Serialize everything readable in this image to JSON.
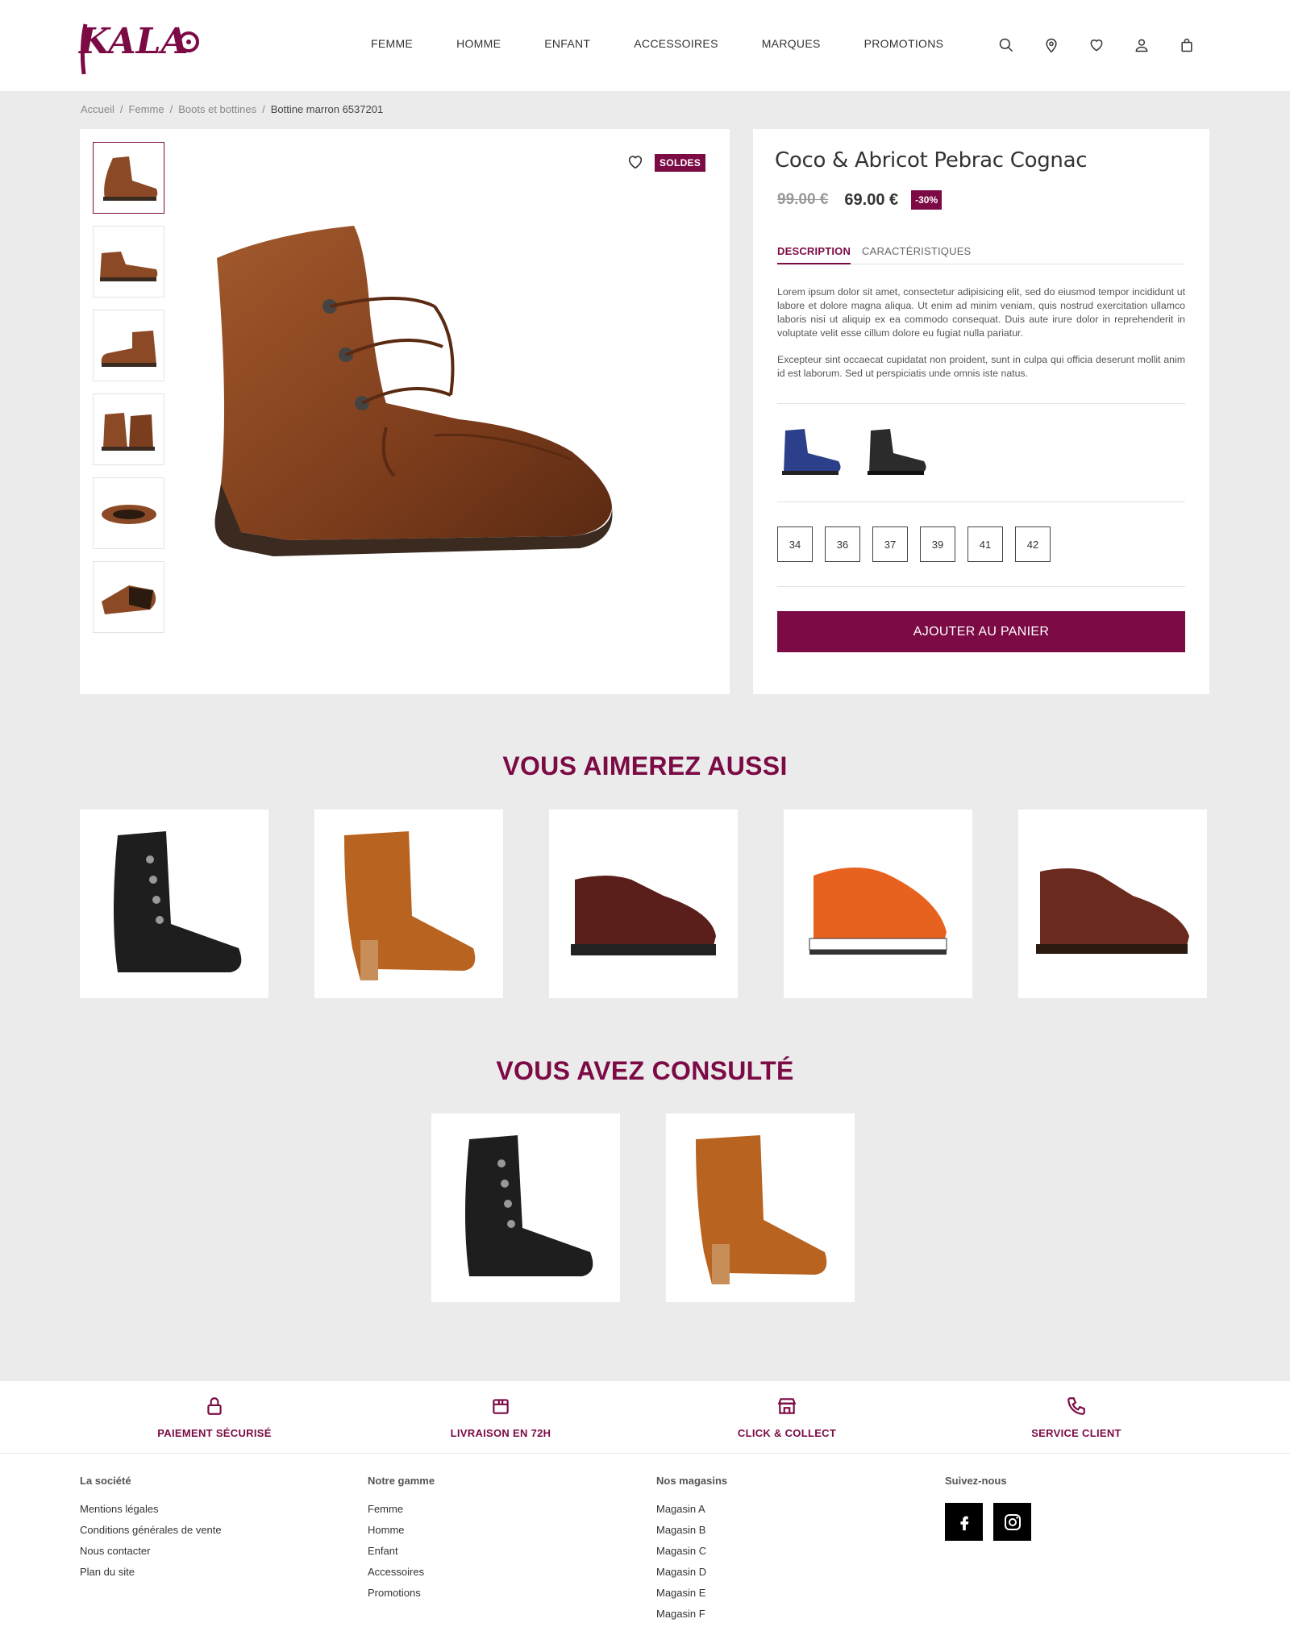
{
  "brand": {
    "logo_text": "KALAO",
    "accent": "#7b0a45"
  },
  "nav": [
    "FEMME",
    "HOMME",
    "ENFANT",
    "ACCESSOIRES",
    "MARQUES",
    "PROMOTIONS"
  ],
  "header_icons": [
    "search-icon",
    "location-pin-icon",
    "heart-icon",
    "user-icon",
    "shopping-bag-icon"
  ],
  "breadcrumb": [
    "Accueil",
    "/",
    "Femme",
    "/",
    "Boots et bottines",
    "/",
    "Bottine marron 6537201"
  ],
  "product": {
    "sale_badge": "SOLDES",
    "title": "Coco & Abricot Pebrac Cognac",
    "old_price": "99.00 €",
    "new_price": "69.00 €",
    "discount": "-30%",
    "tabs": [
      "DESCRIPTION",
      "CARACTÉRISTIQUES"
    ],
    "description": [
      "Lorem ipsum dolor sit amet, consectetur adipisicing elit, sed do eiusmod tempor incididunt ut labore et dolore magna aliqua. Ut enim ad minim veniam, quis nostrud exercitation ullamco laboris nisi ut aliquip ex ea commodo consequat. Duis aute irure dolor in reprehenderit in voluptate velit esse cillum dolore eu fugiat nulla pariatur.",
      "Excepteur sint occaecat cupidatat non proident, sunt in culpa qui officia deserunt mollit anim id est laborum. Sed ut perspiciatis unde omnis iste natus."
    ],
    "sizes": [
      "34",
      "36",
      "37",
      "39",
      "41",
      "42"
    ],
    "add_to_cart": "AJOUTER AU PANIER",
    "variant_colors": [
      "#2c3f8a",
      "#2b2b2b"
    ],
    "main_color": "#8b4a25"
  },
  "sections": {
    "also_like": "VOUS AIMEREZ AUSSI",
    "viewed": "VOUS AVEZ CONSULTÉ"
  },
  "reassurance": [
    {
      "label": "PAIEMENT SÉCURISÉ",
      "icon": "lock-icon"
    },
    {
      "label": "LIVRAISON EN 72H",
      "icon": "package-icon"
    },
    {
      "label": "CLICK & COLLECT",
      "icon": "store-icon"
    },
    {
      "label": "SERVICE CLIENT",
      "icon": "phone-icon"
    }
  ],
  "footer": {
    "col1": {
      "title": "La société",
      "links": [
        "Mentions légales",
        "Conditions générales de vente",
        "Nous contacter",
        "Plan du site"
      ]
    },
    "col2": {
      "title": "Notre gamme",
      "links": [
        "Femme",
        "Homme",
        "Enfant",
        "Accessoires",
        "Promotions"
      ]
    },
    "col3": {
      "title": "Nos magasins",
      "links": [
        "Magasin A",
        "Magasin B",
        "Magasin C",
        "Magasin D",
        "Magasin E",
        "Magasin F"
      ]
    },
    "col4": {
      "title": "Suivez-nous",
      "social": [
        "facebook-icon",
        "instagram-icon"
      ]
    }
  }
}
